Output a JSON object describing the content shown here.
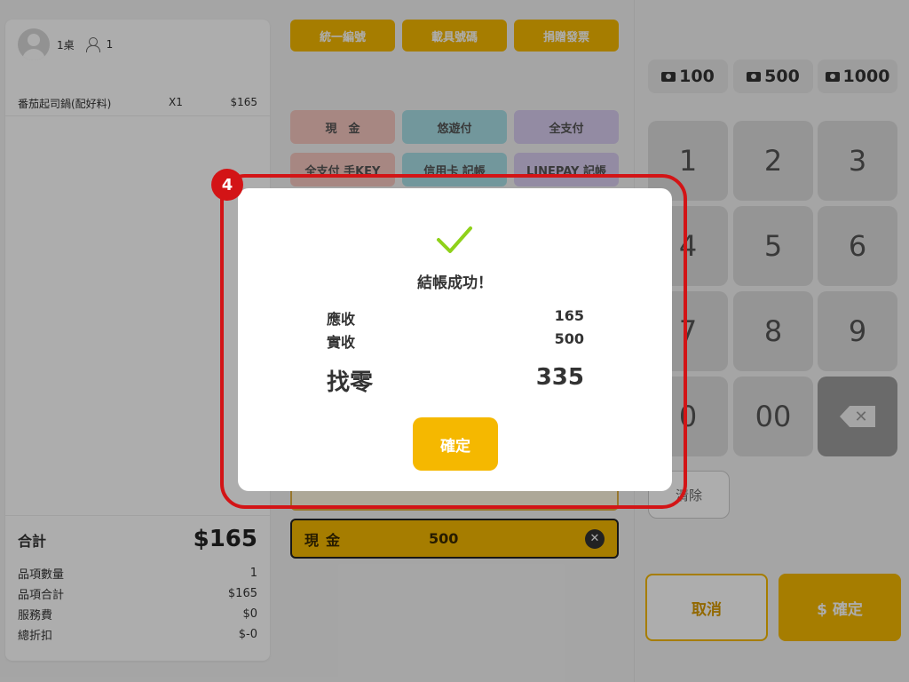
{
  "order": {
    "table": "1桌",
    "guests": "1",
    "items": [
      {
        "name": "番茄起司鍋(配好料)",
        "qty": "X1",
        "price": "$165"
      }
    ],
    "total_label": "合計",
    "total_value": "$165",
    "summary": [
      {
        "label": "品項數量",
        "value": "1"
      },
      {
        "label": "品項合計",
        "value": "$165"
      },
      {
        "label": "服務費",
        "value": "$0"
      },
      {
        "label": "總折扣",
        "value": "$-0"
      }
    ]
  },
  "invoice_buttons": [
    "統一編號",
    "載具號碼",
    "捐贈發票"
  ],
  "payment_methods": {
    "row1": [
      "現　金",
      "悠遊付",
      "全支付"
    ],
    "row2": [
      "全支付 手KEY",
      "信用卡 記帳",
      "LINEPAY 記帳"
    ]
  },
  "payment_line": {
    "method": "現金",
    "amount": "500"
  },
  "keypad": {
    "quick_cash": [
      "100",
      "500",
      "1000"
    ],
    "keys": [
      "1",
      "2",
      "3",
      "4",
      "5",
      "6",
      "7",
      "8",
      "9",
      "0",
      "00"
    ],
    "clear_label": "清除",
    "cancel_label": "取消",
    "confirm_label": "$ 確定"
  },
  "modal": {
    "title": "結帳成功！",
    "rows": [
      {
        "label": "應收",
        "value": "165"
      },
      {
        "label": "實收",
        "value": "500"
      },
      {
        "label": "找零",
        "value": "335"
      }
    ],
    "confirm_label": "確定",
    "check_color": "#8fd11a"
  },
  "annotation": {
    "number": "4",
    "color": "#d31416"
  }
}
